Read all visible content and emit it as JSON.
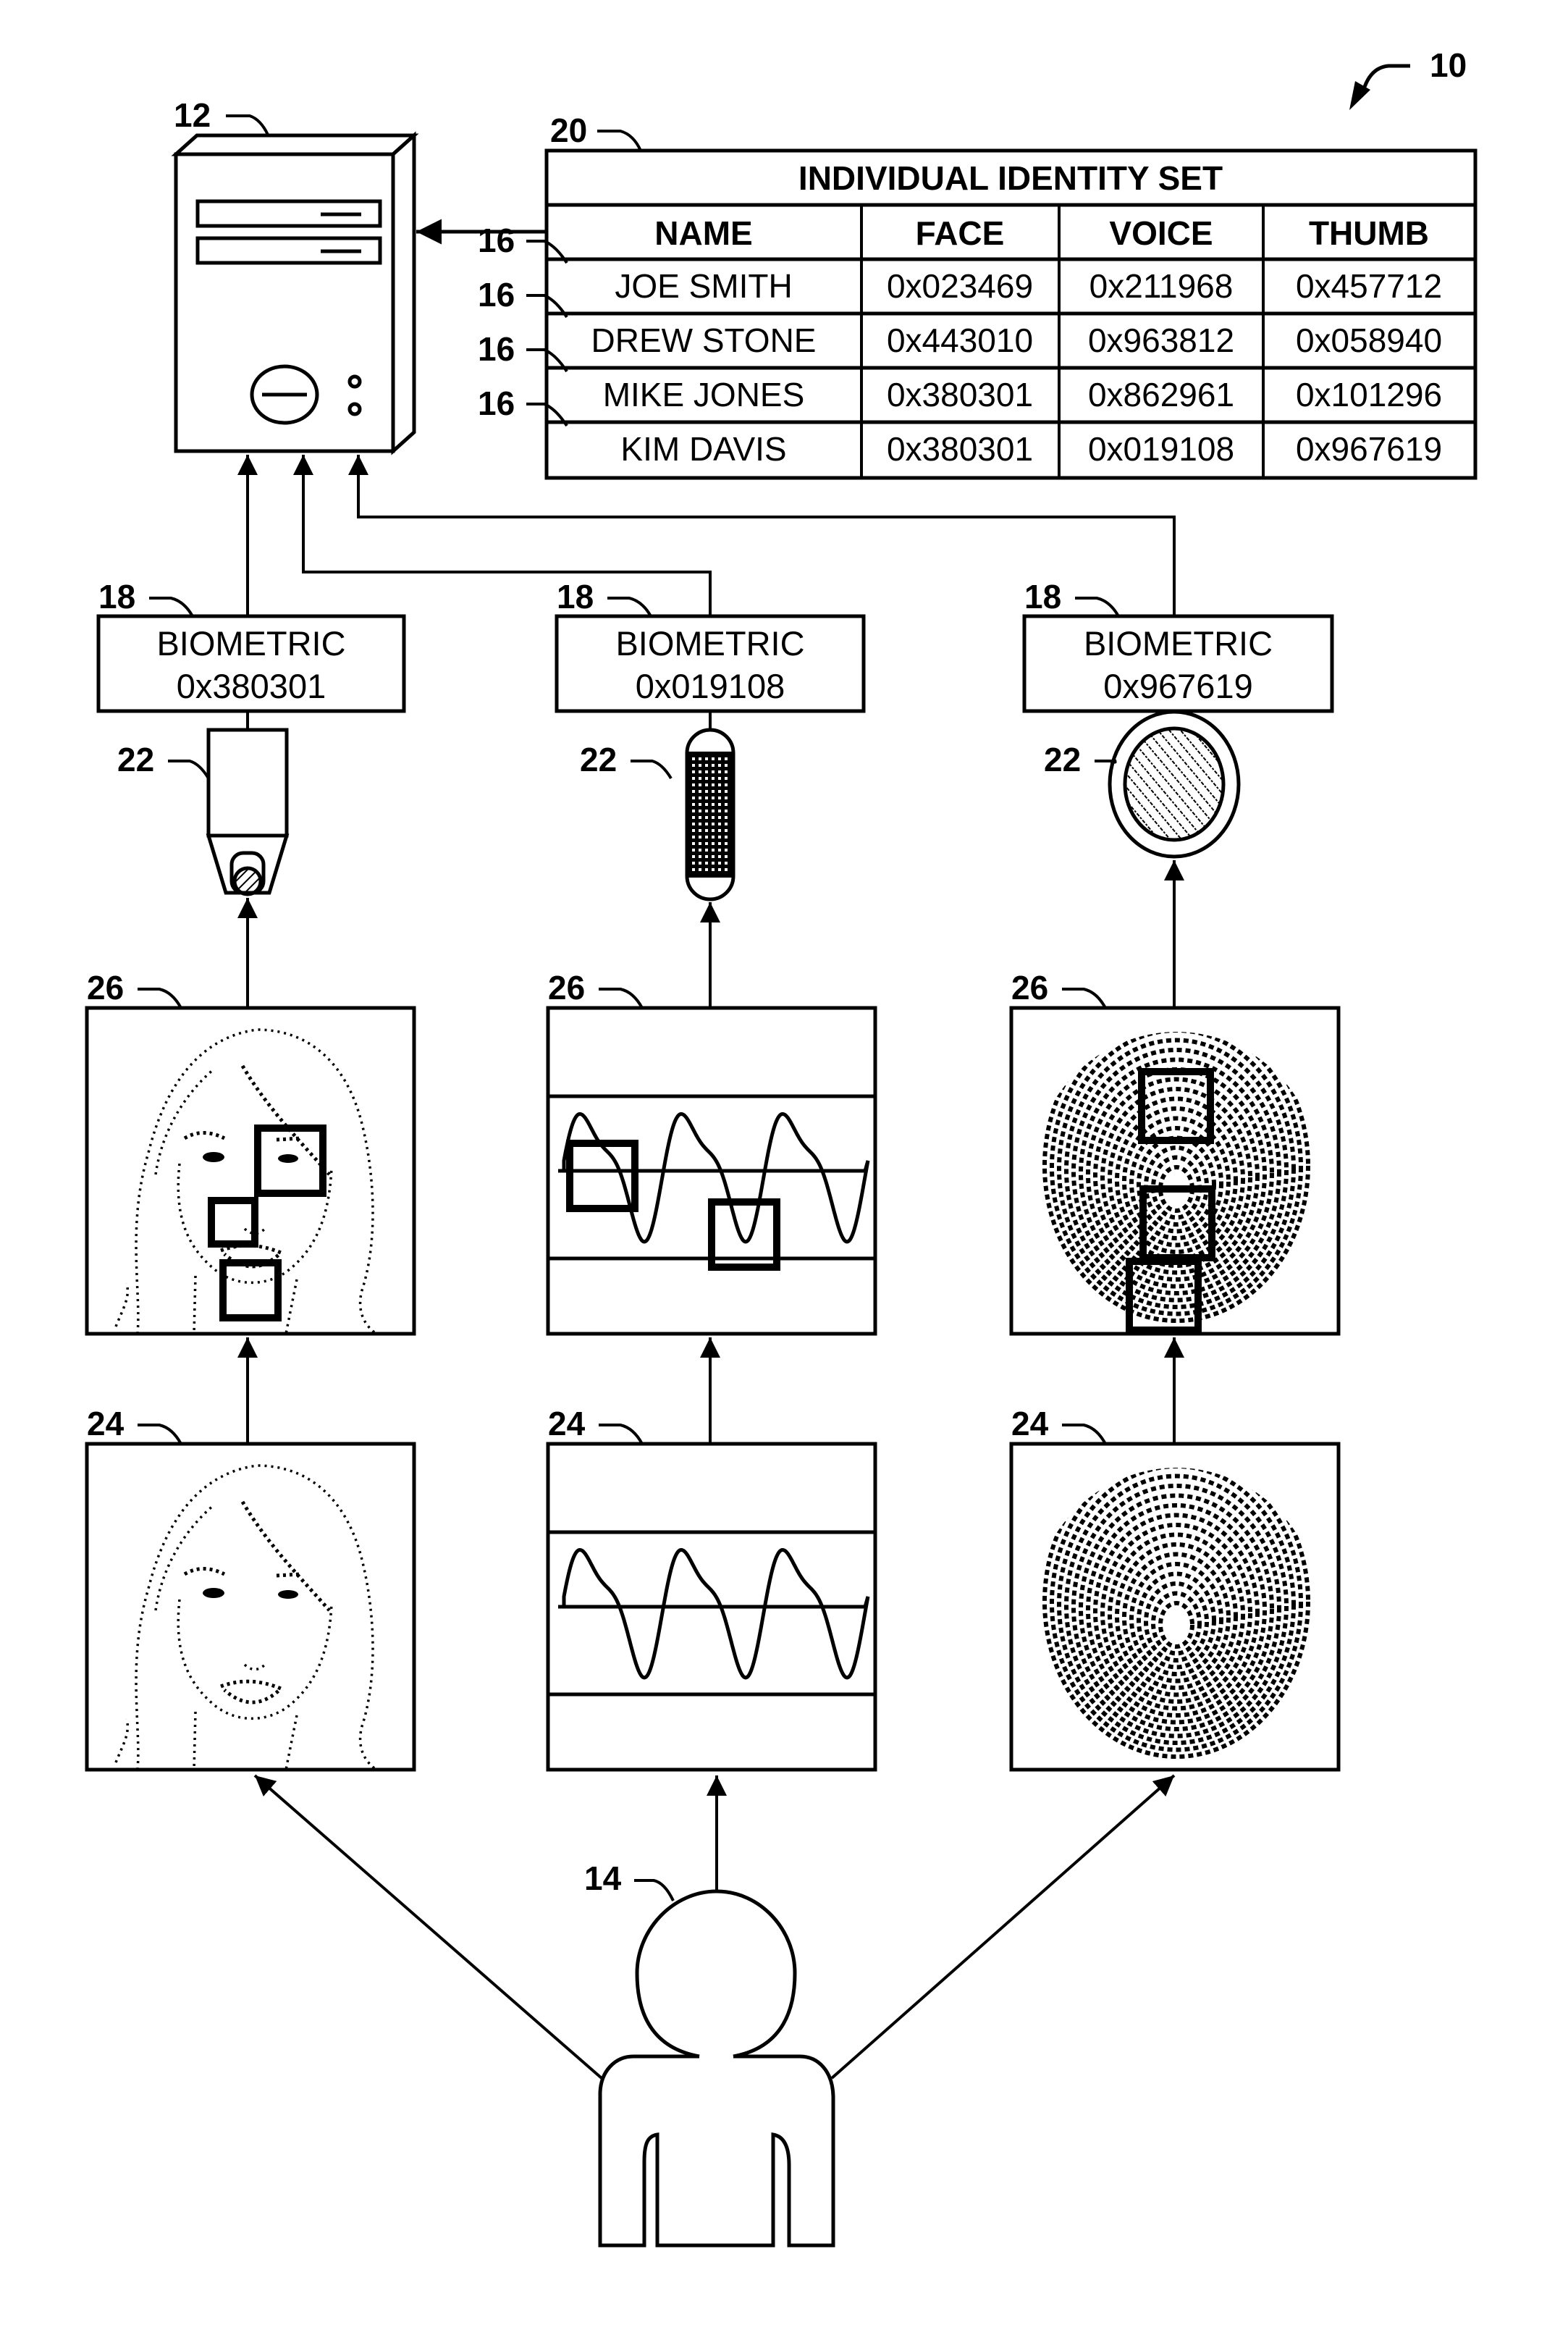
{
  "figure_ref": "10",
  "server": {
    "ref": "12",
    "icon": "server-tower-icon"
  },
  "identity_table": {
    "ref": "20",
    "title": "INDIVIDUAL IDENTITY SET",
    "columns": [
      "NAME",
      "FACE",
      "VOICE",
      "THUMB"
    ],
    "rows": [
      {
        "ref": "16",
        "cells": [
          "JOE SMITH",
          "0x023469",
          "0x211968",
          "0x457712"
        ]
      },
      {
        "ref": "16",
        "cells": [
          "DREW STONE",
          "0x443010",
          "0x963812",
          "0x058940"
        ]
      },
      {
        "ref": "16",
        "cells": [
          "MIKE JONES",
          "0x380301",
          "0x862961",
          "0x101296"
        ]
      },
      {
        "ref": "16",
        "cells": [
          "KIM DAVIS",
          "0x380301",
          "0x019108",
          "0x967619"
        ]
      }
    ]
  },
  "channels": [
    {
      "kind": "face",
      "biometric": {
        "ref": "18",
        "label": "BIOMETRIC",
        "value": "0x380301"
      },
      "sensor": {
        "ref": "22",
        "icon": "camera-icon"
      },
      "processed": {
        "ref": "26",
        "icon": "face-features-icon"
      },
      "raw": {
        "ref": "24",
        "icon": "face-portrait-icon"
      }
    },
    {
      "kind": "voice",
      "biometric": {
        "ref": "18",
        "label": "BIOMETRIC",
        "value": "0x019108"
      },
      "sensor": {
        "ref": "22",
        "icon": "microphone-icon"
      },
      "processed": {
        "ref": "26",
        "icon": "waveform-features-icon"
      },
      "raw": {
        "ref": "24",
        "icon": "waveform-icon"
      }
    },
    {
      "kind": "thumb",
      "biometric": {
        "ref": "18",
        "label": "BIOMETRIC",
        "value": "0x967619"
      },
      "sensor": {
        "ref": "22",
        "icon": "fingerprint-scanner-icon"
      },
      "processed": {
        "ref": "26",
        "icon": "fingerprint-features-icon"
      },
      "raw": {
        "ref": "24",
        "icon": "fingerprint-icon"
      }
    }
  ],
  "person": {
    "ref": "14",
    "icon": "person-icon"
  }
}
